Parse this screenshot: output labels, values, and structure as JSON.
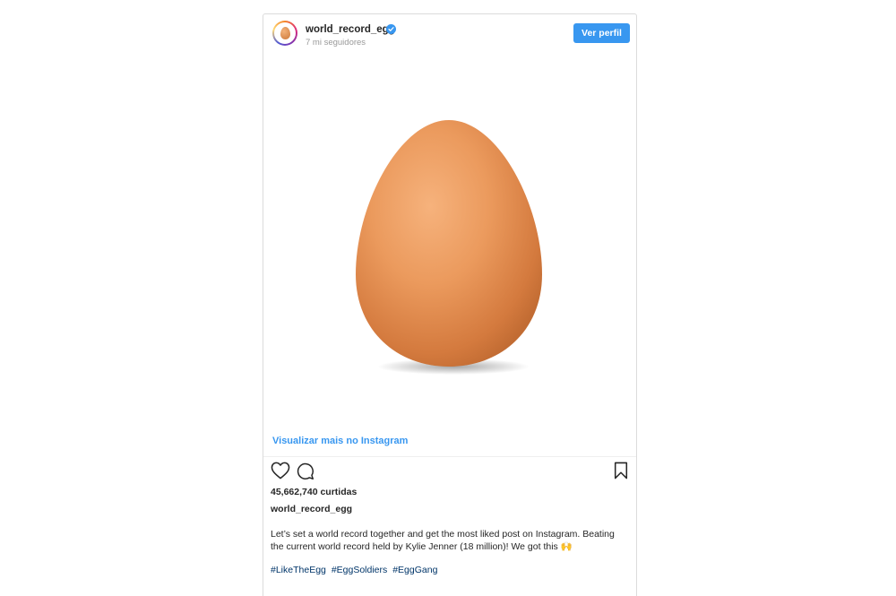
{
  "post": {
    "username": "world_record_egg",
    "followers": "7 mi seguidores",
    "profile_button": "Ver perfil",
    "view_more": "Visualizar mais no Instagram",
    "likes": "45,662,740 curtidas",
    "caption_author": "world_record_egg",
    "caption_line1": "Let’s set a world record together and get the most liked post on Instagram. Beating",
    "caption_line2": "the current world record held by Kylie Jenner (18 million)! We got this 🙌",
    "hashtags": [
      "#LikeTheEgg",
      "#EggSoldiers",
      "#EggGang"
    ]
  },
  "icons": {
    "verified": "verified-badge-icon",
    "like": "heart-icon",
    "comment": "comment-icon",
    "save": "bookmark-icon"
  },
  "colors": {
    "accent": "#3897f0",
    "hashtag": "#003569",
    "egg": "#e8955a"
  }
}
